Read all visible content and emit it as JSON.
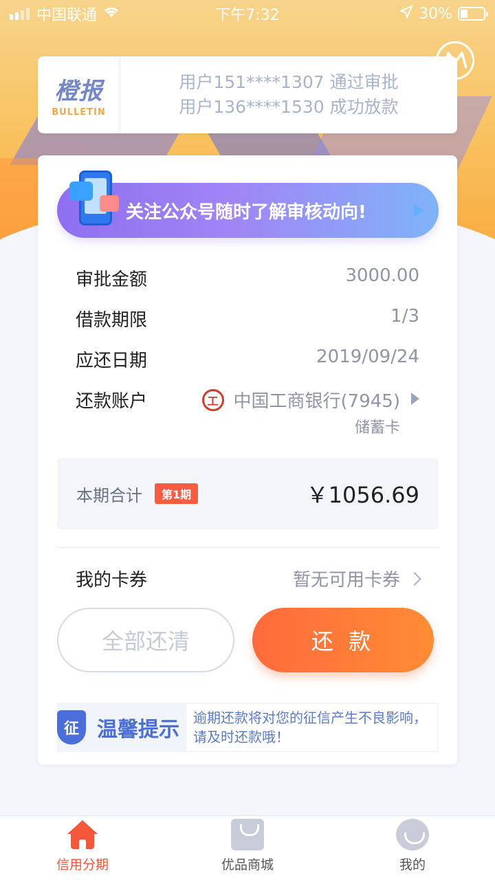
{
  "status_bar": {
    "carrier": "中国联通",
    "time": "下午7:32",
    "battery": "30%"
  },
  "bulletin": {
    "logo_text": "橙报",
    "logo_sub": "BULLETIN",
    "lines": [
      "用户151****1307 通过审批",
      "用户136****1530 成功放款"
    ]
  },
  "banner": {
    "text": "关注公众号随时了解审核动向!"
  },
  "loan": {
    "rows": [
      {
        "label": "审批金额",
        "value": "3000.00"
      },
      {
        "label": "借款期限",
        "value": "1/3"
      },
      {
        "label": "应还日期",
        "value": "2019/09/24"
      }
    ],
    "account": {
      "label": "还款账户",
      "bank_icon": "工",
      "bank_name": "中国工商银行(7945)",
      "card_type": "储蓄卡"
    }
  },
  "total": {
    "label": "本期合计",
    "badge": "第1期",
    "amount": "￥1056.69"
  },
  "coupon": {
    "label": "我的卡券",
    "value": "暂无可用卡券"
  },
  "buttons": {
    "clear_all": "全部还清",
    "repay": "还 款"
  },
  "tip": {
    "icon_char": "征",
    "title": "温馨提示",
    "message": "逾期还款将对您的征信产生不良影响，请及时还款哦！"
  },
  "tabs": [
    {
      "label": "信用分期",
      "icon": "home-icon",
      "active": true
    },
    {
      "label": "优品商城",
      "icon": "shopping-bag-icon",
      "active": false
    },
    {
      "label": "我的",
      "icon": "profile-icon",
      "active": false
    }
  ],
  "colors": {
    "accent": "#f4573a",
    "pay_button_start": "#ff6a3c",
    "pay_button_end": "#ff8c35",
    "tip_blue": "#4a6fd8"
  }
}
